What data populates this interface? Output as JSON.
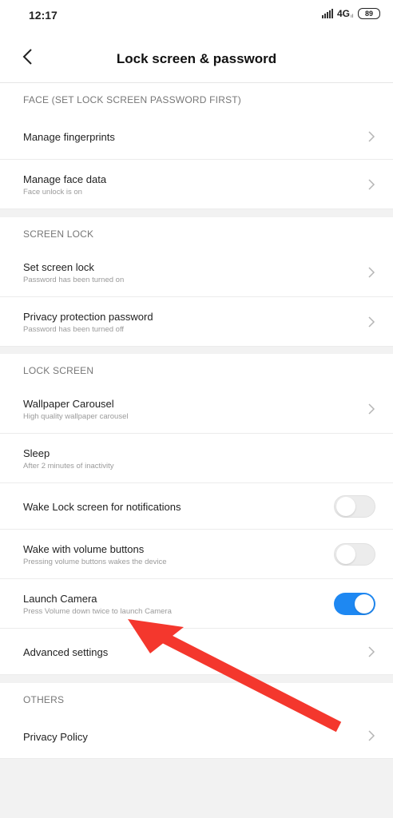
{
  "status_bar": {
    "time": "12:17",
    "network": "4G",
    "network_sub": "ıl",
    "battery": "89"
  },
  "header": {
    "title": "Lock screen & password"
  },
  "sections": {
    "face": {
      "label": "FACE (SET LOCK SCREEN PASSWORD FIRST)"
    },
    "screen_lock": {
      "label": "SCREEN LOCK"
    },
    "lock_screen": {
      "label": "LOCK SCREEN"
    },
    "others": {
      "label": "OTHERS"
    }
  },
  "items": {
    "manage_fingerprints": {
      "title": "Manage fingerprints"
    },
    "manage_face_data": {
      "title": "Manage face data",
      "subtitle": "Face unlock is on"
    },
    "set_screen_lock": {
      "title": "Set screen lock",
      "subtitle": "Password has been turned on"
    },
    "privacy_protection": {
      "title": "Privacy protection password",
      "subtitle": "Password has been turned off"
    },
    "wallpaper_carousel": {
      "title": "Wallpaper Carousel",
      "subtitle": "High quality wallpaper carousel"
    },
    "sleep": {
      "title": "Sleep",
      "subtitle": "After 2 minutes of inactivity"
    },
    "wake_notifications": {
      "title": "Wake Lock screen for notifications",
      "enabled": false
    },
    "wake_volume": {
      "title": "Wake with volume buttons",
      "subtitle": "Pressing volume buttons wakes the device",
      "enabled": false
    },
    "launch_camera": {
      "title": "Launch Camera",
      "subtitle": "Press Volume down twice to launch Camera",
      "enabled": true
    },
    "advanced_settings": {
      "title": "Advanced settings"
    },
    "privacy_policy": {
      "title": "Privacy Policy"
    }
  },
  "colors": {
    "toggle_on": "#1e88f2",
    "annotation_arrow": "#f4372d"
  },
  "icons": {
    "back": "back-arrow-icon",
    "chevron": "chevron-right-icon"
  }
}
